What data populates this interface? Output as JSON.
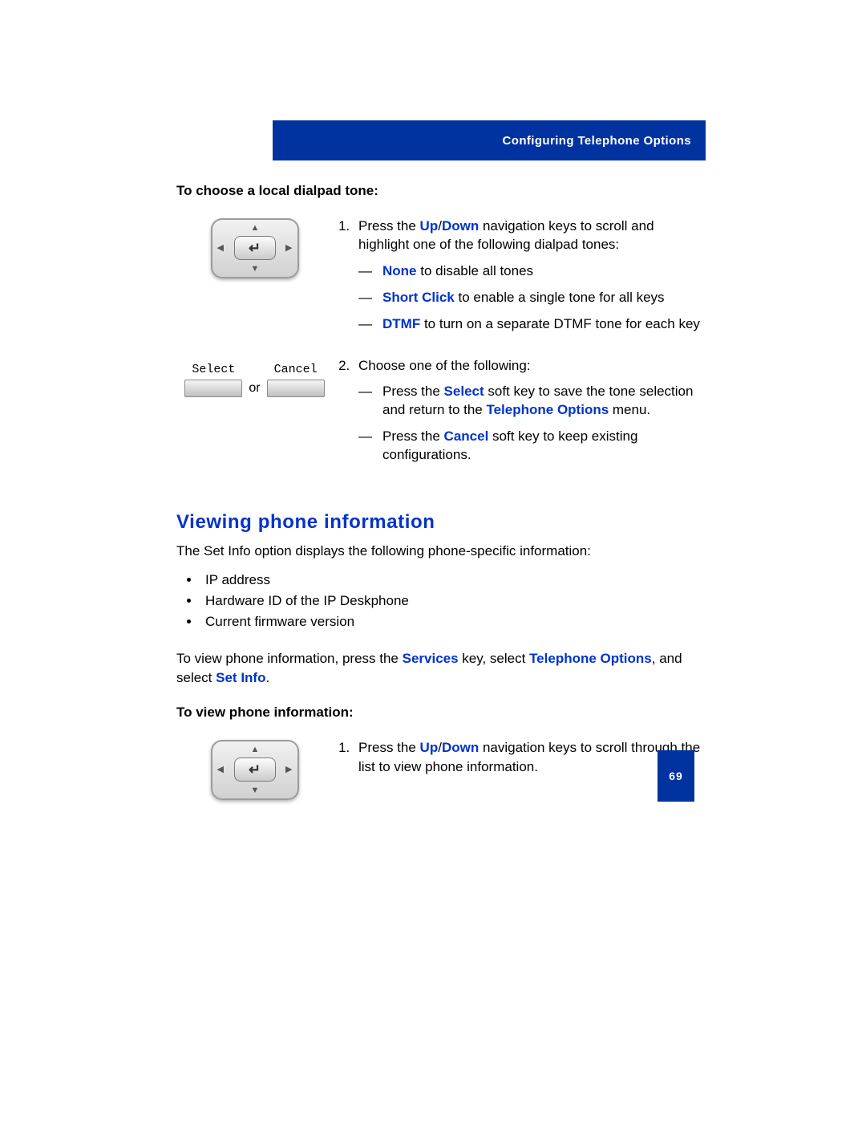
{
  "header": {
    "title": "Configuring Telephone Options"
  },
  "section1": {
    "lead": "To choose a local dialpad tone:",
    "step1": {
      "pre": "Press the ",
      "key1": "Up",
      "sep": "/",
      "key2": "Down",
      "post": " navigation keys to scroll and highlight one of the following dialpad tones:"
    },
    "options": {
      "none": {
        "term": "None",
        "text": " to disable all tones"
      },
      "short": {
        "term": "Short Click",
        "text": " to enable a single tone for all keys"
      },
      "dtmf": {
        "term": "DTMF",
        "text": " to turn on a separate DTMF tone for each key"
      }
    },
    "step2": {
      "lead": "Choose one of the following:",
      "a": {
        "pre": "Press the ",
        "key": "Select",
        "mid": " soft key to save the tone selection and return to the ",
        "menu": "Telephone Options",
        "post": " menu."
      },
      "b": {
        "pre": "Press the ",
        "key": "Cancel",
        "post": " soft key to keep existing configurations."
      }
    },
    "softkeys": {
      "select": "Select",
      "cancel": "Cancel",
      "or": "or"
    }
  },
  "section2": {
    "heading": "Viewing phone information",
    "intro": "The Set Info option displays the following phone-specific information:",
    "bullets": [
      "IP address",
      "Hardware ID of the IP Deskphone",
      "Current firmware version"
    ],
    "nav": {
      "pre": "To view phone information, press the ",
      "k1": "Services",
      "mid1": " key, select ",
      "k2": "Telephone Options",
      "mid2": ", and select ",
      "k3": "Set Info",
      "post": "."
    },
    "lead2": "To view phone information:",
    "step1": {
      "pre": "Press the ",
      "key1": "Up",
      "sep": "/",
      "key2": "Down",
      "post": " navigation keys to scroll through the list to view phone information."
    }
  },
  "page_number": "69"
}
